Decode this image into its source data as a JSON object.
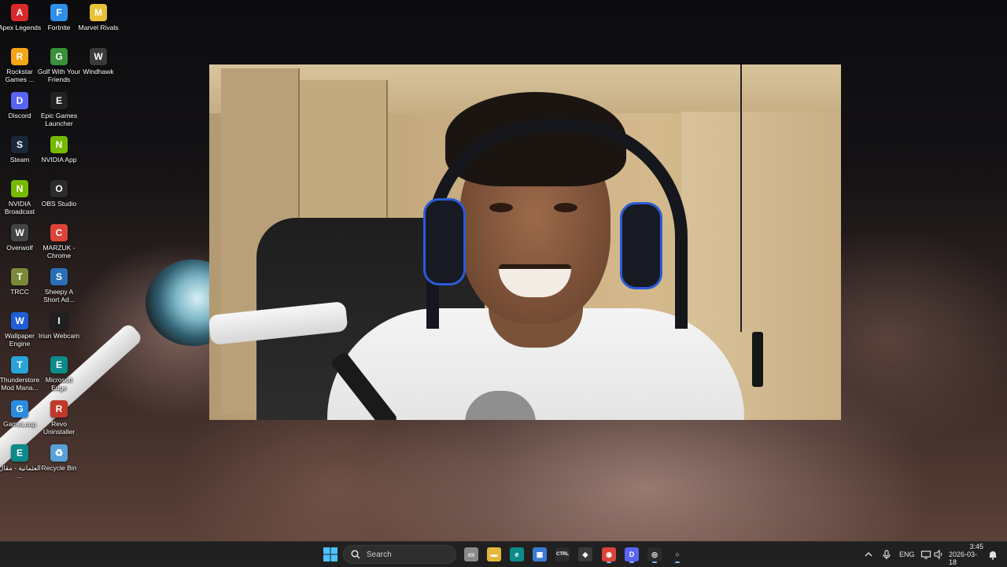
{
  "desktop": {
    "icons": [
      {
        "label": "Apex Legends",
        "icon": "apex-legends-icon",
        "color": "#d92a2a",
        "glyph": "A"
      },
      {
        "label": "Fortnite",
        "icon": "fortnite-icon",
        "color": "#2f8fe8",
        "glyph": "F"
      },
      {
        "label": "Marvel Rivals",
        "icon": "marvel-rivals-icon",
        "color": "#e8c235",
        "glyph": "M"
      },
      {
        "label": "Rockstar Games ...",
        "icon": "rockstar-games-icon",
        "color": "#f3a515",
        "glyph": "R"
      },
      {
        "label": "Golf With Your Friends",
        "icon": "golf-with-your-friends-icon",
        "color": "#3a8f3a",
        "glyph": "G"
      },
      {
        "label": "Windhawk",
        "icon": "windhawk-icon",
        "color": "#3a3a3a",
        "glyph": "W"
      },
      {
        "label": "Discord",
        "icon": "discord-icon",
        "color": "#5865f2",
        "glyph": "D"
      },
      {
        "label": "Epic Games Launcher",
        "icon": "epic-games-icon",
        "color": "#222222",
        "glyph": "E"
      },
      {
        "label": "Steam",
        "icon": "steam-icon",
        "color": "#1b2838",
        "glyph": "S"
      },
      {
        "label": "NVIDIA App",
        "icon": "nvidia-app-icon",
        "color": "#76b900",
        "glyph": "N"
      },
      {
        "label": "NVIDIA Broadcast",
        "icon": "nvidia-broadcast-icon",
        "color": "#76b900",
        "glyph": "N"
      },
      {
        "label": "OBS Studio",
        "icon": "obs-studio-icon",
        "color": "#2b2b2b",
        "glyph": "O"
      },
      {
        "label": "Overwolf",
        "icon": "overwolf-icon",
        "color": "#444444",
        "glyph": "W"
      },
      {
        "label": "MARZUK - Chrome",
        "icon": "chrome-icon",
        "color": "#db4437",
        "glyph": "C"
      },
      {
        "label": "TRCC",
        "icon": "trcc-icon",
        "color": "#7a8a3a",
        "glyph": "T"
      },
      {
        "label": "Sheepy A Short Ad...",
        "icon": "sheepy-icon",
        "color": "#2a6fb5",
        "glyph": "S"
      },
      {
        "label": "Wallpaper Engine",
        "icon": "wallpaper-engine-icon",
        "color": "#1f5fd6",
        "glyph": "W"
      },
      {
        "label": "Iriun Webcam",
        "icon": "iriun-webcam-icon",
        "color": "#202020",
        "glyph": "I"
      },
      {
        "label": "Thunderstore Mod Mana...",
        "icon": "thunderstore-icon",
        "color": "#2aa4d8",
        "glyph": "T"
      },
      {
        "label": "Microsoft Edge",
        "icon": "edge-icon",
        "color": "#0c8a8a",
        "glyph": "E"
      },
      {
        "label": "GameLoop",
        "icon": "gameloop-icon",
        "color": "#2a8be0",
        "glyph": "G"
      },
      {
        "label": "Revo Uninstaller",
        "icon": "revo-uninstaller-icon",
        "color": "#c0392b",
        "glyph": "R"
      },
      {
        "label": "العثمانية - مقال ...",
        "icon": "edge-shortcut-icon",
        "color": "#0c8a8a",
        "glyph": "E"
      },
      {
        "label": "Recycle Bin",
        "icon": "recycle-bin-icon",
        "color": "#5aa0d8",
        "glyph": "♻"
      }
    ]
  },
  "webcam_window": {
    "name": "webcam-video-feed"
  },
  "taskbar": {
    "search_label": "Search",
    "pinned": [
      {
        "icon": "task-view-icon",
        "color": "#8a8a8a",
        "glyph": "▭"
      },
      {
        "icon": "file-explorer-icon",
        "color": "#e6b83a",
        "glyph": "▬"
      },
      {
        "icon": "edge-icon",
        "color": "#0c8a8a",
        "glyph": "e"
      },
      {
        "icon": "microsoft-store-icon",
        "color": "#3a7bd5",
        "glyph": "▦"
      },
      {
        "icon": "ctrl-app-icon",
        "color": "#2b2b2b",
        "glyph": "CTRL"
      },
      {
        "icon": "cube-app-icon",
        "color": "#3a3a3a",
        "glyph": "◆"
      },
      {
        "icon": "chrome-icon",
        "color": "#db4437",
        "glyph": "◉"
      },
      {
        "icon": "discord-icon",
        "color": "#5865f2",
        "glyph": "D"
      },
      {
        "icon": "obs-studio-icon",
        "color": "#2b2b2b",
        "glyph": "◎"
      },
      {
        "icon": "iriun-webcam-icon",
        "color": "#202020",
        "glyph": "○"
      }
    ],
    "tray": {
      "language": "ENG",
      "time": "3:45",
      "date": "2026-03-18"
    }
  }
}
